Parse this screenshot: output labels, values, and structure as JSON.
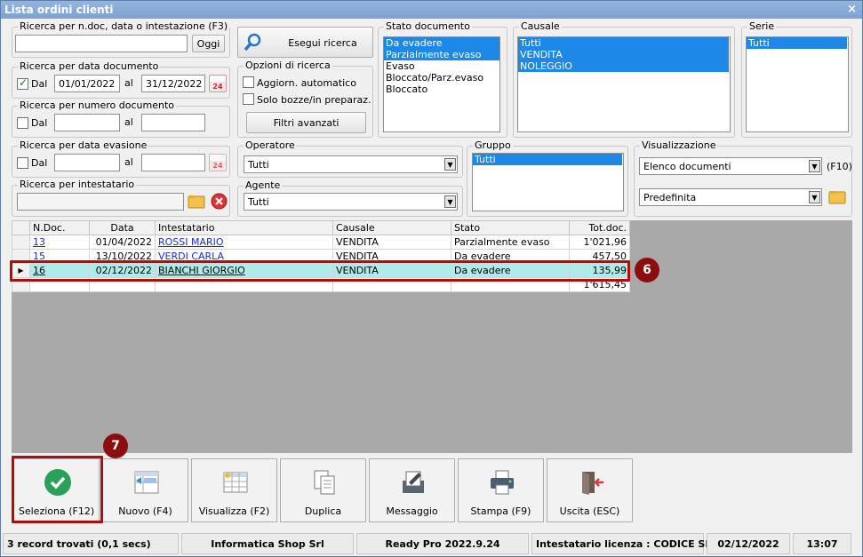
{
  "window": {
    "title": "Lista ordini clienti",
    "close_glyph": "×"
  },
  "search_ndoc": {
    "legend": "Ricerca per n.doc, data o intestazione (F3)",
    "value": "",
    "today_button": "Oggi"
  },
  "execute_button": "Esegui ricerca",
  "search_date": {
    "legend": "Ricerca per data documento",
    "checkbox_label": "Dal",
    "checked": true,
    "from": "01/01/2022",
    "to_label": "al",
    "to": "31/12/2022"
  },
  "search_number": {
    "legend": "Ricerca per numero documento",
    "checkbox_label": "Dal",
    "checked": false,
    "from": "",
    "to_label": "al",
    "to": ""
  },
  "options": {
    "legend": "Opzioni di ricerca",
    "auto_update": "Aggiorn. automatico",
    "drafts_only": "Solo bozze/in preparaz.",
    "advanced_filters": "Filtri avanzati"
  },
  "doc_state": {
    "legend": "Stato documento",
    "items": [
      {
        "label": "Da evadere",
        "selected": true
      },
      {
        "label": "Parzialmente evaso",
        "selected": true
      },
      {
        "label": "Evaso",
        "selected": false
      },
      {
        "label": "Bloccato/Parz.evaso",
        "selected": false
      },
      {
        "label": "Bloccato",
        "selected": false
      }
    ]
  },
  "causale": {
    "legend": "Causale",
    "items": [
      {
        "label": "Tutti",
        "selected": true
      },
      {
        "label": "VENDITA",
        "selected": true
      },
      {
        "label": "NOLEGGIO",
        "selected": true
      }
    ]
  },
  "serie": {
    "legend": "Serie",
    "items": [
      {
        "label": "Tutti",
        "selected": true
      }
    ]
  },
  "search_evasion": {
    "legend": "Ricerca per data evasione",
    "checkbox_label": "Dal",
    "checked": false,
    "from": "",
    "to_label": "al",
    "to": ""
  },
  "operatore": {
    "legend": "Operatore",
    "value": "Tutti"
  },
  "gruppo": {
    "legend": "Gruppo",
    "items": [
      {
        "label": "Tutti",
        "selected": true
      }
    ]
  },
  "visualizzazione": {
    "legend": "Visualizzazione",
    "value": "Elenco documenti",
    "shortcut": "(F10)",
    "layout": "Predefinita"
  },
  "search_holder": {
    "legend": "Ricerca per intestatario",
    "value": ""
  },
  "agente": {
    "legend": "Agente",
    "value": "Tutti"
  },
  "calendar_day": "24",
  "grid": {
    "columns": [
      "N.Doc.",
      "Data",
      "Intestatario",
      "Causale",
      "Stato",
      "Tot.doc."
    ],
    "rows": [
      {
        "ndoc": "13",
        "data": "01/04/2022",
        "intestatario": "ROSSI MARIO",
        "causale": "VENDITA",
        "stato": "Parzialmente evaso",
        "tot": "1'021,96",
        "current": false
      },
      {
        "ndoc": "15",
        "data": "13/10/2022",
        "intestatario": "VERDI CARLA",
        "causale": "VENDITA",
        "stato": "Da evadere",
        "tot": "457,50",
        "current": false
      },
      {
        "ndoc": "16",
        "data": "02/12/2022",
        "intestatario": "BIANCHI GIORGIO",
        "causale": "VENDITA",
        "stato": "Da evadere",
        "tot": "135,99",
        "current": true
      }
    ],
    "total": "1'615,45"
  },
  "annotations": {
    "row_badge": "6",
    "button_badge": "7"
  },
  "toolbar": [
    {
      "label": "Seleziona (F12)",
      "icon": "check-circle-icon"
    },
    {
      "label": "Nuovo (F4)",
      "icon": "new-document-icon"
    },
    {
      "label": "Visualizza (F2)",
      "icon": "view-table-icon"
    },
    {
      "label": "Duplica",
      "icon": "duplicate-icon"
    },
    {
      "label": "Messaggio",
      "icon": "message-icon"
    },
    {
      "label": "Stampa (F9)",
      "icon": "printer-icon"
    },
    {
      "label": "Uscita (ESC)",
      "icon": "exit-door-icon"
    }
  ],
  "statusbar": {
    "records": "3 record trovati (0,1 secs)",
    "company": "Informatica Shop Srl",
    "version": "Ready Pro 2022.9.24",
    "license": "Intestatario licenza : CODICE SRL",
    "date": "02/12/2022",
    "time": "13:07"
  },
  "colors": {
    "title_bar": "#7ea2d2",
    "selection": "#1e88e8",
    "current_row": "#aeeceb",
    "annotation": "#8b0d0d",
    "confirm_green": "#2aa05a"
  }
}
